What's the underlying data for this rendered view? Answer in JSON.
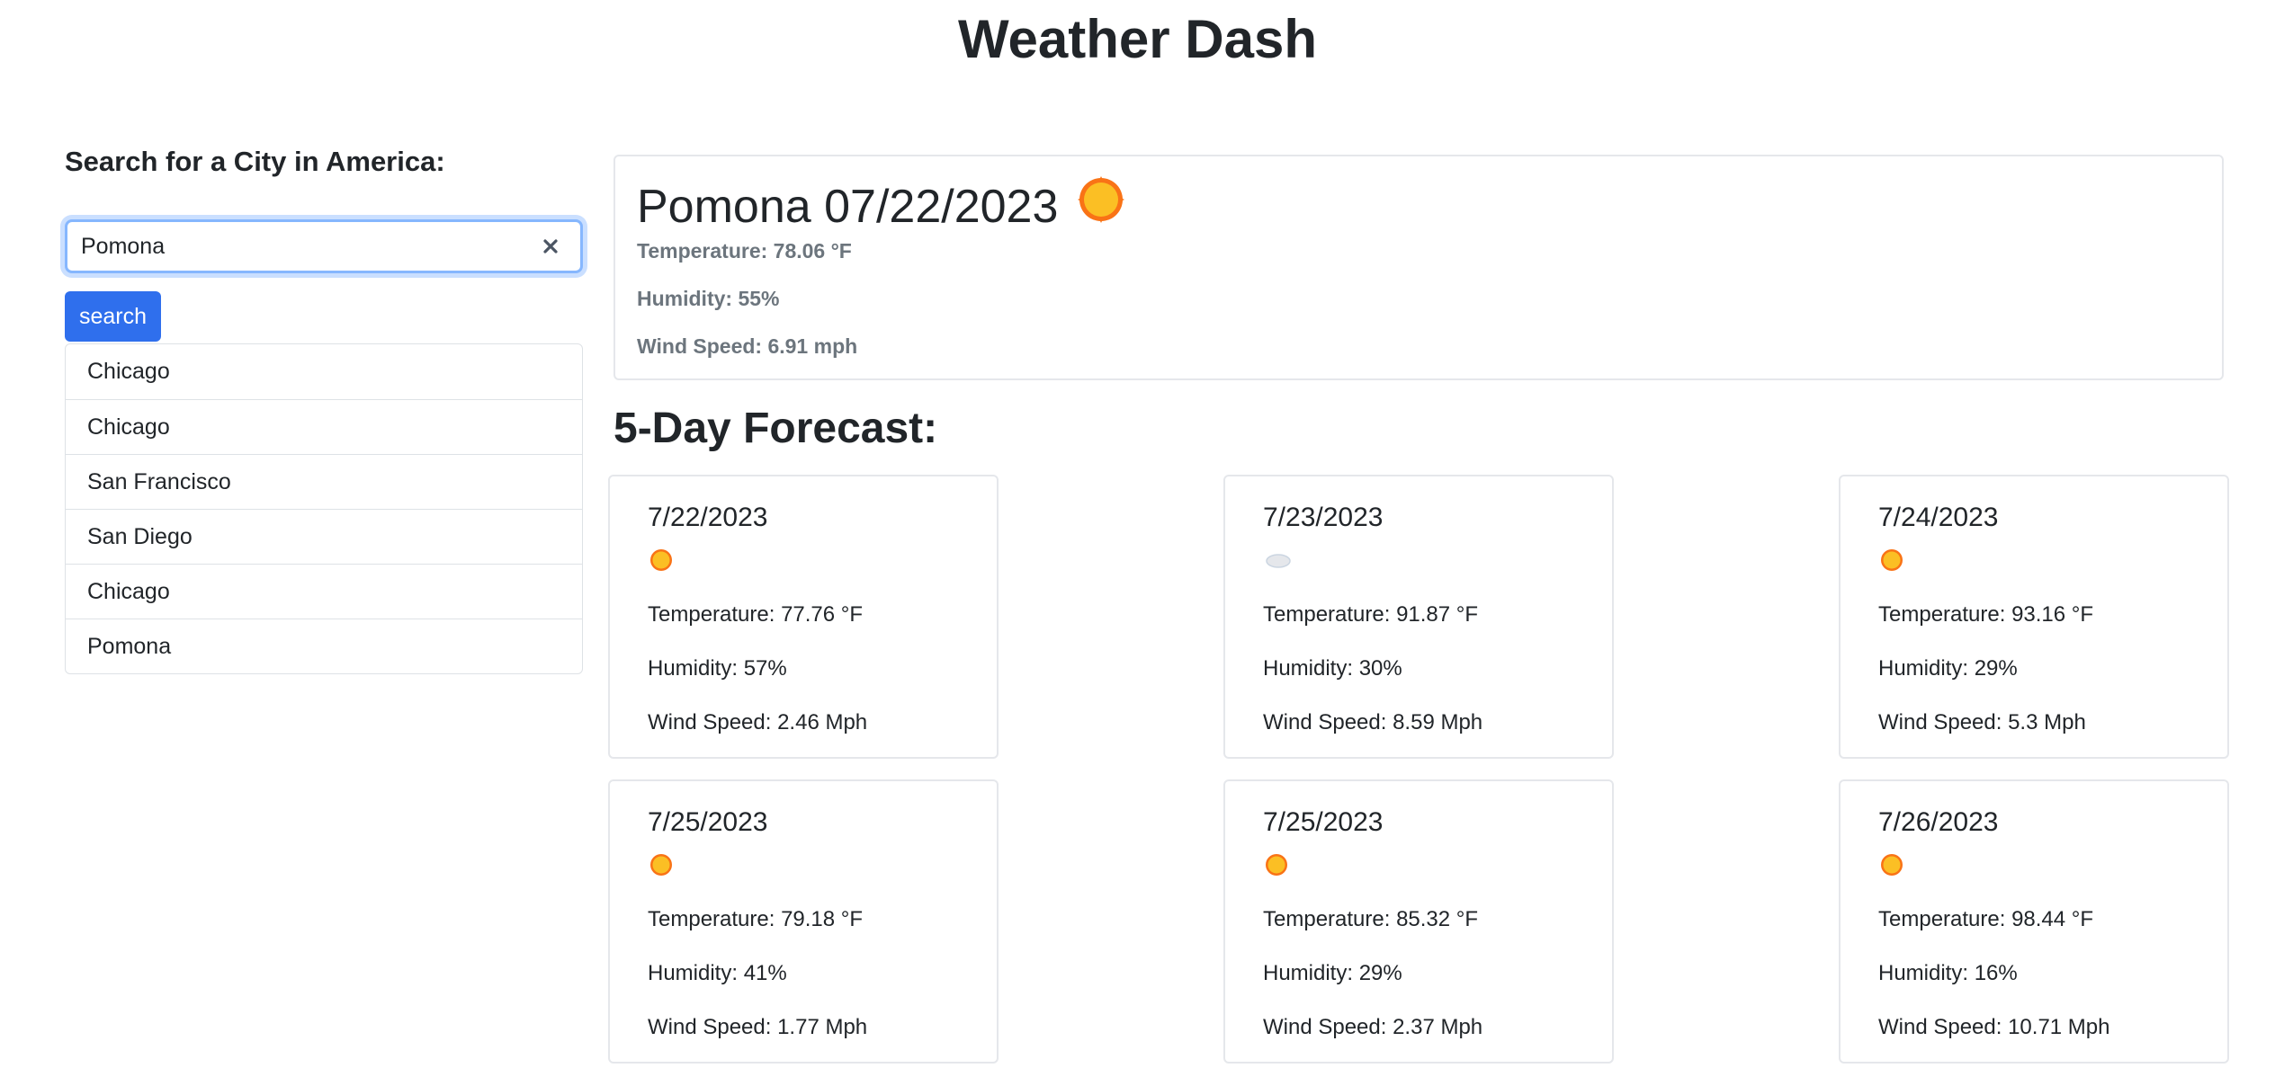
{
  "app": {
    "title": "Weather Dash"
  },
  "search": {
    "heading": "Search for a City in America:",
    "input_value": "Pomona",
    "button_label": "search",
    "clear_icon": "close-icon"
  },
  "history": [
    "Chicago",
    "Chicago",
    "San Francisco",
    "San Diego",
    "Chicago",
    "Pomona"
  ],
  "current": {
    "heading": "Pomona 07/22/2023",
    "icon": "sun-icon",
    "temperature": "Temperature: 78.06 °F",
    "humidity": "Humidity: 55%",
    "wind": "Wind Speed: 6.91 mph"
  },
  "forecast": {
    "title": "5-Day Forecast:",
    "days": [
      {
        "date": "7/22/2023",
        "icon": "sun-icon",
        "temperature": "Temperature: 77.76 °F",
        "humidity": "Humidity: 57%",
        "wind": "Wind Speed: 2.46 Mph"
      },
      {
        "date": "7/23/2023",
        "icon": "cloud-icon",
        "temperature": "Temperature: 91.87 °F",
        "humidity": "Humidity: 30%",
        "wind": "Wind Speed: 8.59 Mph"
      },
      {
        "date": "7/24/2023",
        "icon": "sun-icon",
        "temperature": "Temperature: 93.16 °F",
        "humidity": "Humidity: 29%",
        "wind": "Wind Speed: 5.3 Mph"
      },
      {
        "date": "7/25/2023",
        "icon": "sun-icon",
        "temperature": "Temperature: 79.18 °F",
        "humidity": "Humidity: 41%",
        "wind": "Wind Speed: 1.77 Mph"
      },
      {
        "date": "7/25/2023",
        "icon": "sun-icon",
        "temperature": "Temperature: 85.32 °F",
        "humidity": "Humidity: 29%",
        "wind": "Wind Speed: 2.37 Mph"
      },
      {
        "date": "7/26/2023",
        "icon": "sun-icon",
        "temperature": "Temperature: 98.44 °F",
        "humidity": "Humidity: 16%",
        "wind": "Wind Speed: 10.71 Mph"
      }
    ]
  },
  "colors": {
    "accent": "#2f6fed",
    "sun": "#fbbf24",
    "sun_ray": "#f97316",
    "muted_text": "#6c757d"
  }
}
